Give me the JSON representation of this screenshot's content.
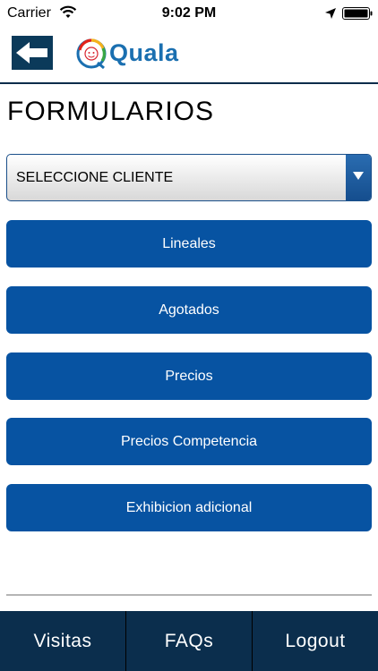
{
  "status_bar": {
    "carrier": "Carrier",
    "time": "9:02 PM"
  },
  "header": {
    "back_icon": "arrow-left-icon",
    "logo_text": "Quala"
  },
  "page": {
    "title": "FORMULARIOS"
  },
  "client_select": {
    "value": "SELECCIONE CLIENTE"
  },
  "buttons": [
    {
      "label": "Lineales"
    },
    {
      "label": "Agotados"
    },
    {
      "label": "Precios"
    },
    {
      "label": "Precios Competencia"
    },
    {
      "label": "Exhibicion adicional"
    }
  ],
  "tabs": [
    {
      "label": "Visitas"
    },
    {
      "label": "FAQs"
    },
    {
      "label": "Logout"
    }
  ],
  "colors": {
    "primary_button": "#0753a2",
    "tab_bar": "#0b2e4d",
    "header_line": "#0b2c4a",
    "logo_blue": "#1a6fb0"
  }
}
